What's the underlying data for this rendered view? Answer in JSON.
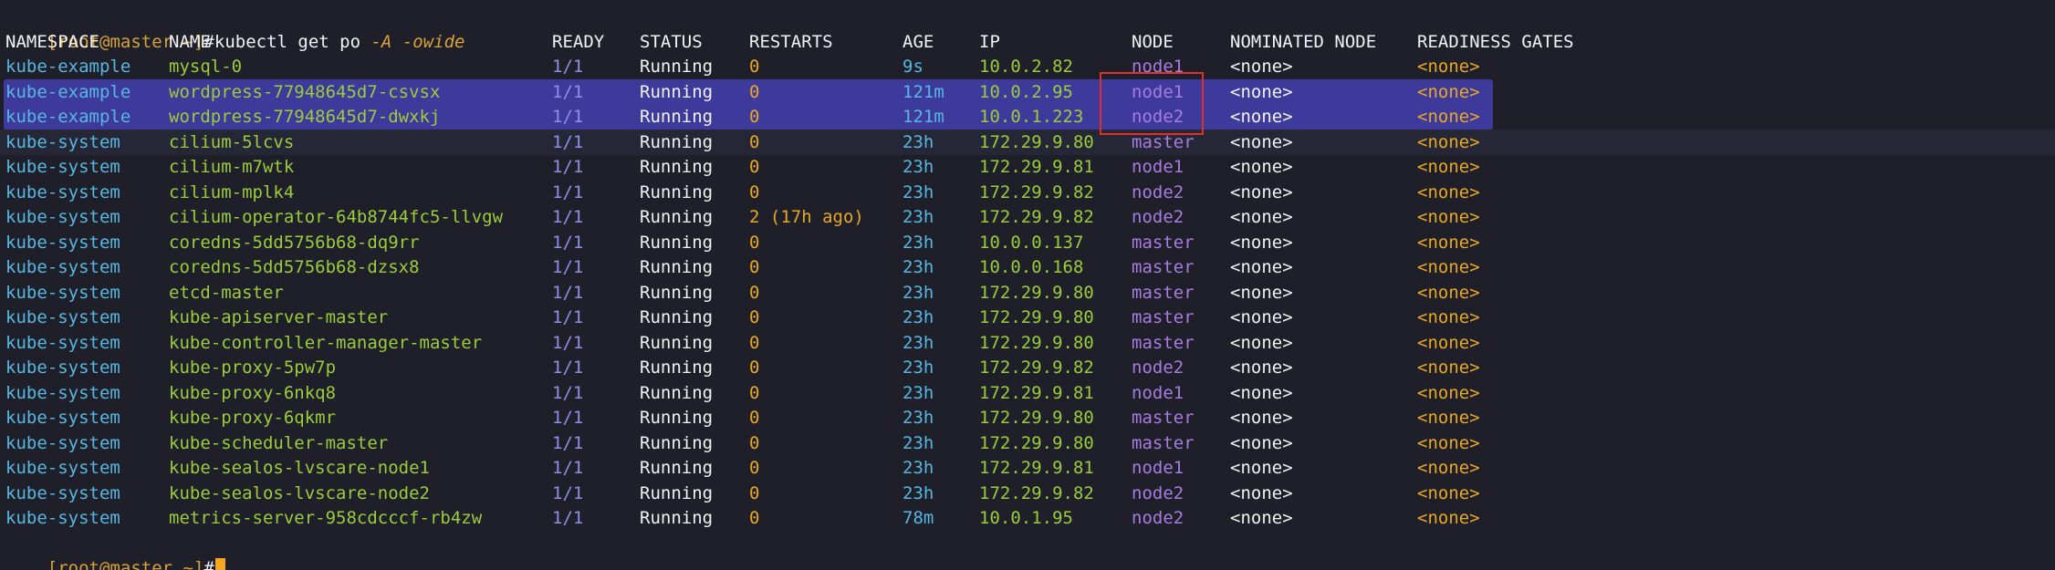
{
  "prompt": {
    "open": "[",
    "user": "root",
    "at": "@",
    "host": "master",
    "path": " ~",
    "close": "]",
    "symbol": "#"
  },
  "command": {
    "text": "kubectl get po ",
    "flag1": "-A",
    "flag2": "-owide"
  },
  "headers": [
    "NAMESPACE",
    "NAME",
    "READY",
    "STATUS",
    "RESTARTS",
    "AGE",
    "IP",
    "NODE",
    "NOMINATED NODE",
    "READINESS GATES"
  ],
  "rows": [
    {
      "namespace": "kube-example",
      "name": "mysql-0",
      "ready": "1/1",
      "status": "Running",
      "restarts": "0",
      "age": "9s",
      "ip": "10.0.2.82",
      "node": "node1",
      "nominated": "<none>",
      "gates": "<none>"
    },
    {
      "namespace": "kube-example",
      "name": "wordpress-77948645d7-csvsx",
      "ready": "1/1",
      "status": "Running",
      "restarts": "0",
      "age": "121m",
      "ip": "10.0.2.95",
      "node": "node1",
      "nominated": "<none>",
      "gates": "<none>"
    },
    {
      "namespace": "kube-example",
      "name": "wordpress-77948645d7-dwxkj",
      "ready": "1/1",
      "status": "Running",
      "restarts": "0",
      "age": "121m",
      "ip": "10.0.1.223",
      "node": "node2",
      "nominated": "<none>",
      "gates": "<none>"
    },
    {
      "namespace": "kube-system",
      "name": "cilium-5lcvs",
      "ready": "1/1",
      "status": "Running",
      "restarts": "0",
      "age": "23h",
      "ip": "172.29.9.80",
      "node": "master",
      "nominated": "<none>",
      "gates": "<none>"
    },
    {
      "namespace": "kube-system",
      "name": "cilium-m7wtk",
      "ready": "1/1",
      "status": "Running",
      "restarts": "0",
      "age": "23h",
      "ip": "172.29.9.81",
      "node": "node1",
      "nominated": "<none>",
      "gates": "<none>"
    },
    {
      "namespace": "kube-system",
      "name": "cilium-mplk4",
      "ready": "1/1",
      "status": "Running",
      "restarts": "0",
      "age": "23h",
      "ip": "172.29.9.82",
      "node": "node2",
      "nominated": "<none>",
      "gates": "<none>"
    },
    {
      "namespace": "kube-system",
      "name": "cilium-operator-64b8744fc5-llvgw",
      "ready": "1/1",
      "status": "Running",
      "restarts": "2 (17h ago)",
      "age": "23h",
      "ip": "172.29.9.82",
      "node": "node2",
      "nominated": "<none>",
      "gates": "<none>"
    },
    {
      "namespace": "kube-system",
      "name": "coredns-5dd5756b68-dq9rr",
      "ready": "1/1",
      "status": "Running",
      "restarts": "0",
      "age": "23h",
      "ip": "10.0.0.137",
      "node": "master",
      "nominated": "<none>",
      "gates": "<none>"
    },
    {
      "namespace": "kube-system",
      "name": "coredns-5dd5756b68-dzsx8",
      "ready": "1/1",
      "status": "Running",
      "restarts": "0",
      "age": "23h",
      "ip": "10.0.0.168",
      "node": "master",
      "nominated": "<none>",
      "gates": "<none>"
    },
    {
      "namespace": "kube-system",
      "name": "etcd-master",
      "ready": "1/1",
      "status": "Running",
      "restarts": "0",
      "age": "23h",
      "ip": "172.29.9.80",
      "node": "master",
      "nominated": "<none>",
      "gates": "<none>"
    },
    {
      "namespace": "kube-system",
      "name": "kube-apiserver-master",
      "ready": "1/1",
      "status": "Running",
      "restarts": "0",
      "age": "23h",
      "ip": "172.29.9.80",
      "node": "master",
      "nominated": "<none>",
      "gates": "<none>"
    },
    {
      "namespace": "kube-system",
      "name": "kube-controller-manager-master",
      "ready": "1/1",
      "status": "Running",
      "restarts": "0",
      "age": "23h",
      "ip": "172.29.9.80",
      "node": "master",
      "nominated": "<none>",
      "gates": "<none>"
    },
    {
      "namespace": "kube-system",
      "name": "kube-proxy-5pw7p",
      "ready": "1/1",
      "status": "Running",
      "restarts": "0",
      "age": "23h",
      "ip": "172.29.9.82",
      "node": "node2",
      "nominated": "<none>",
      "gates": "<none>"
    },
    {
      "namespace": "kube-system",
      "name": "kube-proxy-6nkq8",
      "ready": "1/1",
      "status": "Running",
      "restarts": "0",
      "age": "23h",
      "ip": "172.29.9.81",
      "node": "node1",
      "nominated": "<none>",
      "gates": "<none>"
    },
    {
      "namespace": "kube-system",
      "name": "kube-proxy-6qkmr",
      "ready": "1/1",
      "status": "Running",
      "restarts": "0",
      "age": "23h",
      "ip": "172.29.9.80",
      "node": "master",
      "nominated": "<none>",
      "gates": "<none>"
    },
    {
      "namespace": "kube-system",
      "name": "kube-scheduler-master",
      "ready": "1/1",
      "status": "Running",
      "restarts": "0",
      "age": "23h",
      "ip": "172.29.9.80",
      "node": "master",
      "nominated": "<none>",
      "gates": "<none>"
    },
    {
      "namespace": "kube-system",
      "name": "kube-sealos-lvscare-node1",
      "ready": "1/1",
      "status": "Running",
      "restarts": "0",
      "age": "23h",
      "ip": "172.29.9.81",
      "node": "node1",
      "nominated": "<none>",
      "gates": "<none>"
    },
    {
      "namespace": "kube-system",
      "name": "kube-sealos-lvscare-node2",
      "ready": "1/1",
      "status": "Running",
      "restarts": "0",
      "age": "23h",
      "ip": "172.29.9.82",
      "node": "node2",
      "nominated": "<none>",
      "gates": "<none>"
    },
    {
      "namespace": "kube-system",
      "name": "metrics-server-958cdcccf-rb4zw",
      "ready": "1/1",
      "status": "Running",
      "restarts": "0",
      "age": "78m",
      "ip": "10.0.1.95",
      "node": "node2",
      "nominated": "<none>",
      "gates": "<none>"
    }
  ],
  "colors": {
    "background": "#1e1f29",
    "namespace": "#58b7e0",
    "name": "#9ccc3c",
    "ready": "#8f8fe6",
    "status": "#f2f2f2",
    "restarts": "#e8a825",
    "age": "#58b7e0",
    "ip": "#9ccc3c",
    "node": "#a77be0",
    "nominated": "#f2f2f2",
    "gates": "#e8a825",
    "header": "#f2f2f2",
    "selection": "#3d3a9c",
    "annotation_box": "#e0302a",
    "cursor": "#f5a623"
  }
}
